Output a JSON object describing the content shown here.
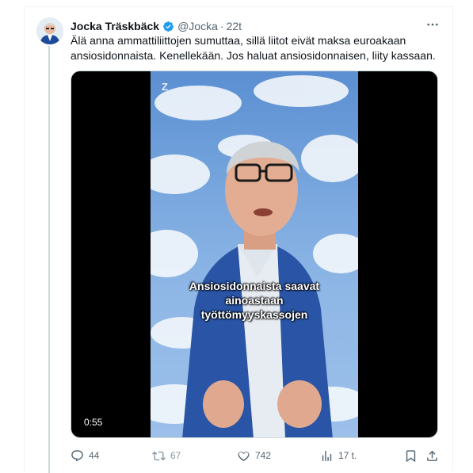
{
  "tweet": {
    "author_name": "Jocka Träskbäck",
    "handle": "@Jocka",
    "separator": "·",
    "time": "22t",
    "text": "Älä anna ammattiliittojen sumuttaa, sillä liitot eivät maksa euroakaan ansiosidonnaista. Kenellekään. Jos haluat ansiosidonnaisen, liity kassaan.",
    "verified_color": "#1d9bf0"
  },
  "video": {
    "caption_lines": [
      "Ansiosidonnaista saavat",
      "ainoastaan",
      "työttömyyskassojen"
    ],
    "duration": "0:55",
    "watermark": "Z"
  },
  "actions": {
    "replies": "44",
    "reposts": "67",
    "likes": "742",
    "views": "17 t."
  },
  "icons": [
    "more-icon",
    "verified-icon",
    "reply-icon",
    "repost-icon",
    "like-icon",
    "views-icon",
    "bookmark-icon",
    "share-icon"
  ]
}
